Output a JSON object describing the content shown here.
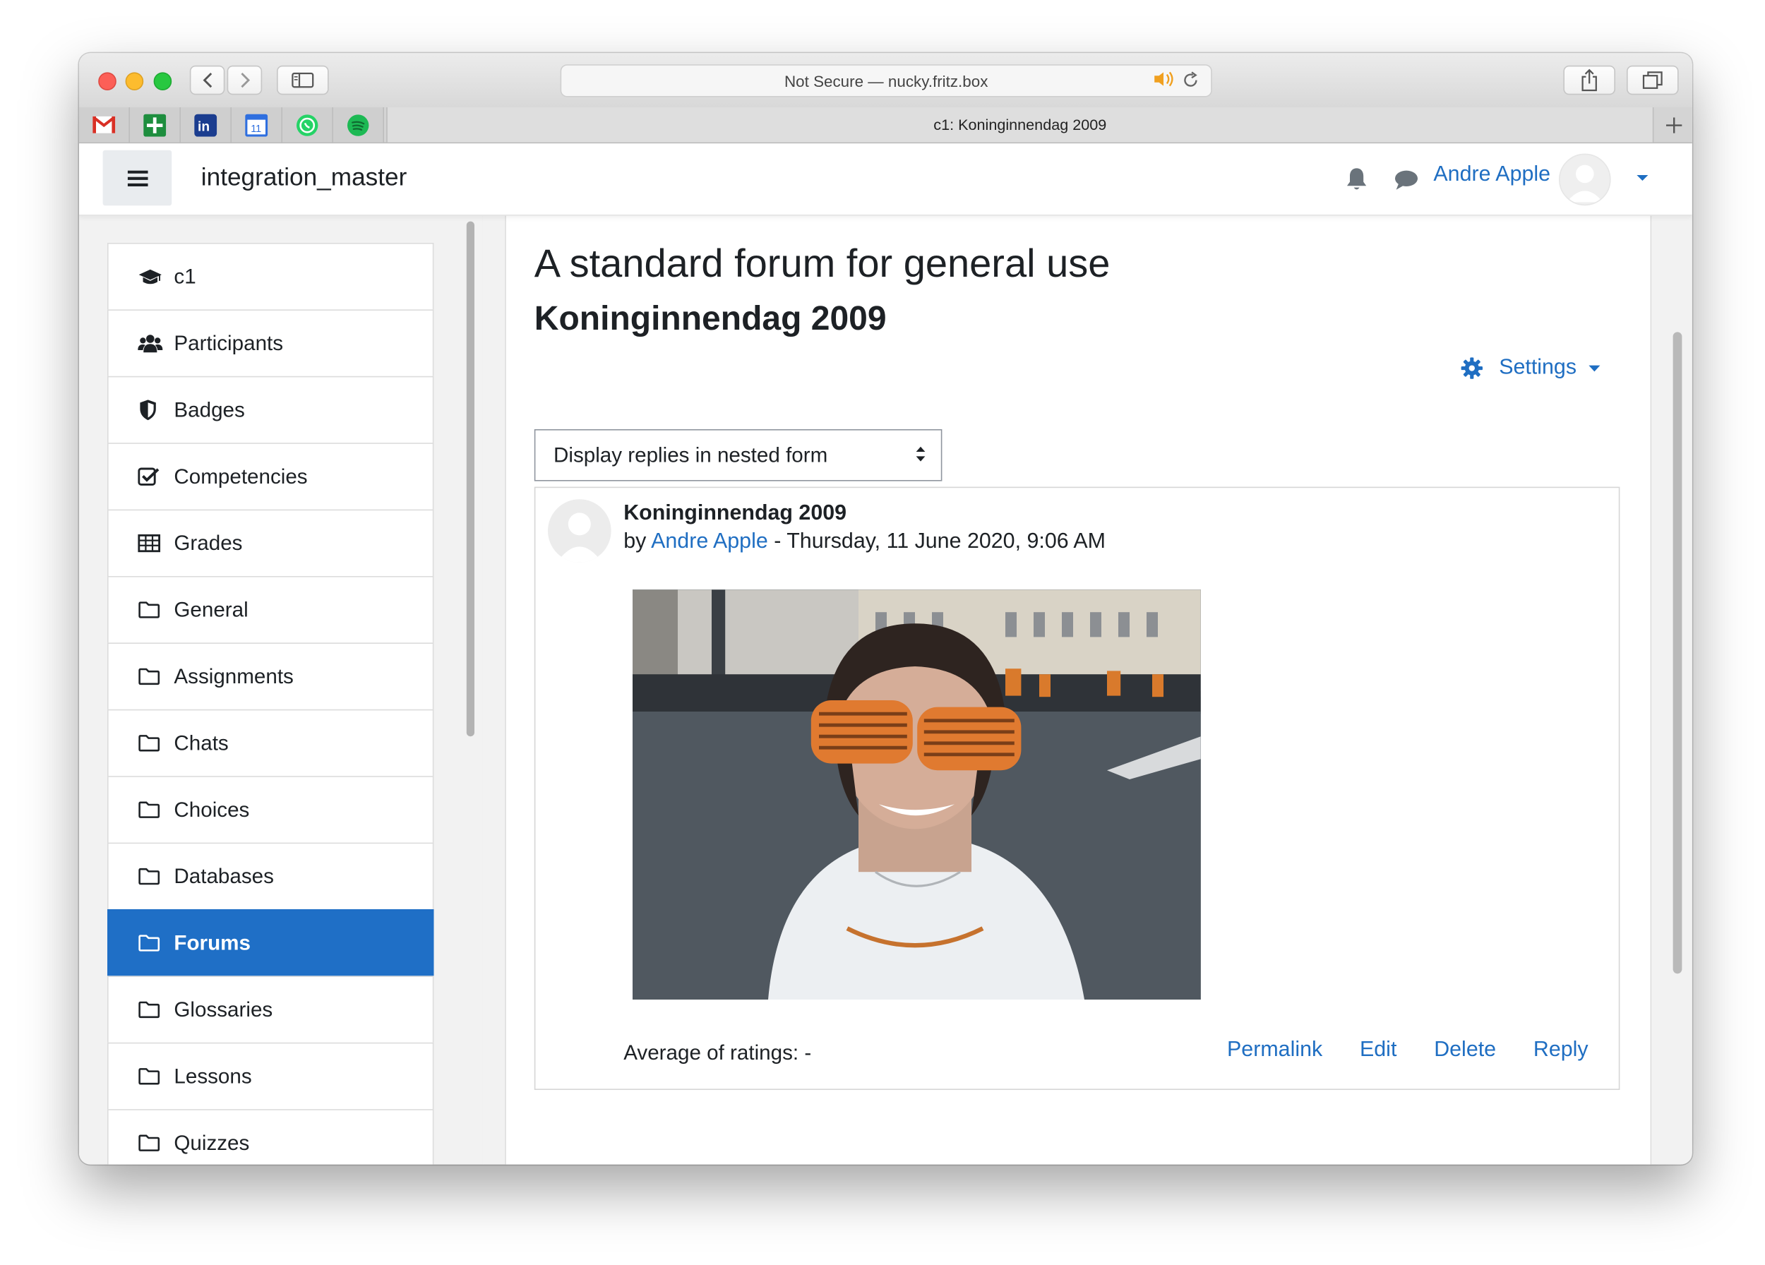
{
  "browser": {
    "address": "Not Secure — nucky.fritz.box",
    "tab_title": "c1: Koninginnendag 2009",
    "favorites": [
      "gmail-icon",
      "sheets-icon",
      "invision-icon",
      "calendar-icon",
      "whatsapp-icon",
      "spotify-icon"
    ],
    "calendar_day": "11"
  },
  "navbar": {
    "site_name": "integration_master",
    "user_name": "Andre Apple"
  },
  "drawer": {
    "items": [
      {
        "label": "c1",
        "icon": "graduation-cap-icon"
      },
      {
        "label": "Participants",
        "icon": "users-icon"
      },
      {
        "label": "Badges",
        "icon": "shield-icon"
      },
      {
        "label": "Competencies",
        "icon": "checkbox-icon"
      },
      {
        "label": "Grades",
        "icon": "table-icon"
      },
      {
        "label": "General",
        "icon": "folder-icon"
      },
      {
        "label": "Assignments",
        "icon": "folder-icon"
      },
      {
        "label": "Chats",
        "icon": "folder-icon"
      },
      {
        "label": "Choices",
        "icon": "folder-icon"
      },
      {
        "label": "Databases",
        "icon": "folder-icon"
      },
      {
        "label": "Forums",
        "icon": "folder-icon",
        "active": true
      },
      {
        "label": "Glossaries",
        "icon": "folder-icon"
      },
      {
        "label": "Lessons",
        "icon": "folder-icon"
      },
      {
        "label": "Quizzes",
        "icon": "folder-icon"
      }
    ]
  },
  "main": {
    "title": "A standard forum for general use",
    "forum_name": "Koninginnendag 2009",
    "settings_label": "Settings",
    "display_mode": "Display replies in nested form",
    "post": {
      "subject": "Koninginnendag 2009",
      "by": "by",
      "author": "Andre Apple",
      "date": " - Thursday, 11 June 2020, 9:06 AM",
      "rating": "Average of ratings: -",
      "actions": {
        "permalink": "Permalink",
        "edit": "Edit",
        "delete": "Delete",
        "reply": "Reply"
      }
    }
  },
  "colors": {
    "accent": "#1f6ec2",
    "active_item": "#1f6fc6"
  }
}
